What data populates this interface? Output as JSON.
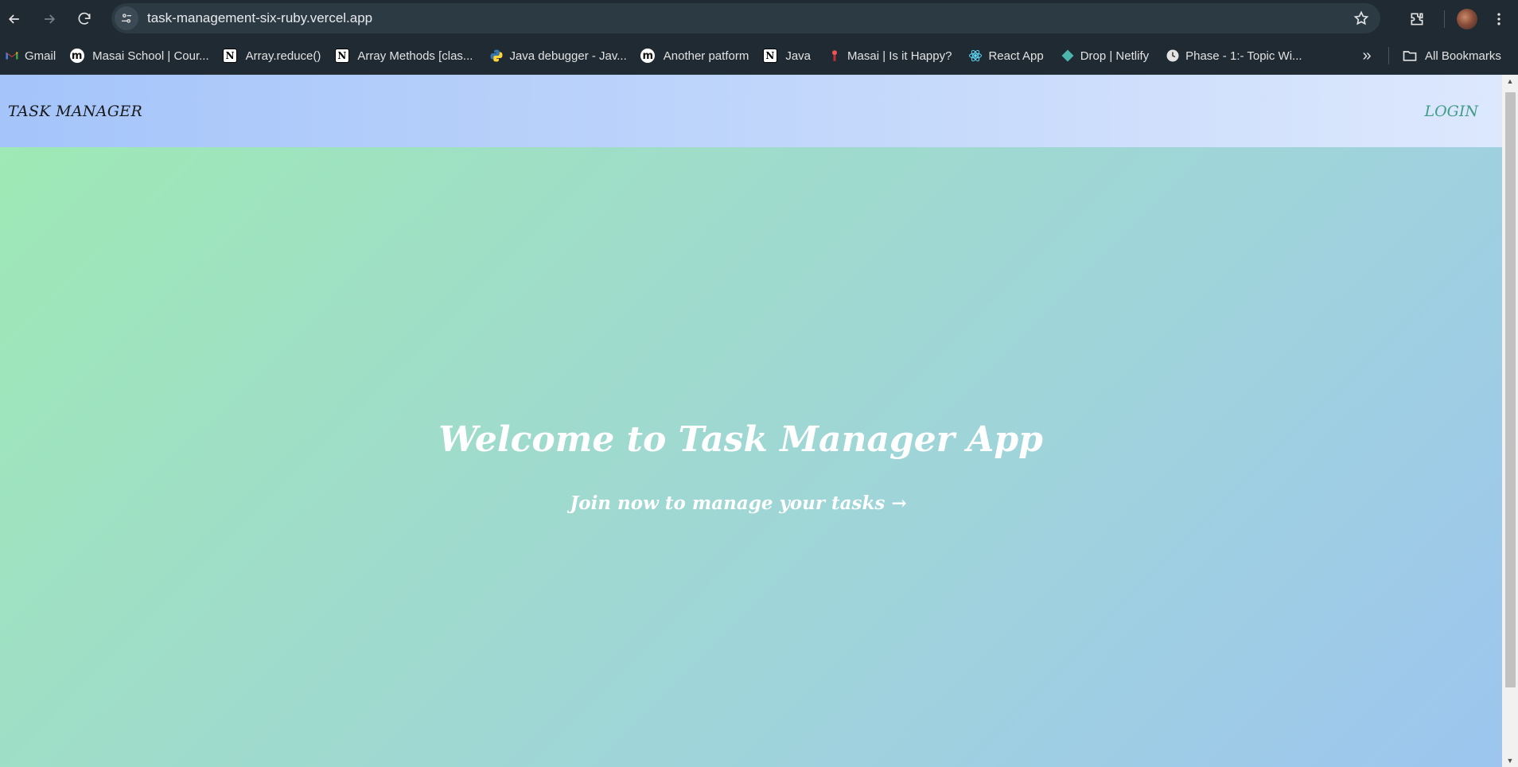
{
  "browser": {
    "url": "task-management-six-ruby.vercel.app",
    "bookmarks": [
      {
        "label": "Gmail",
        "icon": "gmail-icon"
      },
      {
        "label": "Masai School | Cour...",
        "icon": "masai-icon"
      },
      {
        "label": "Array.reduce()",
        "icon": "notion-icon"
      },
      {
        "label": "Array Methods [clas...",
        "icon": "notion-icon"
      },
      {
        "label": "Java debugger - Jav...",
        "icon": "python-icon"
      },
      {
        "label": "Another patform",
        "icon": "masai-icon"
      },
      {
        "label": "Java",
        "icon": "notion-icon"
      },
      {
        "label": "Masai | Is it Happy?",
        "icon": "masai-happy-icon"
      },
      {
        "label": "React App",
        "icon": "react-icon"
      },
      {
        "label": "Drop | Netlify",
        "icon": "netlify-icon"
      },
      {
        "label": "Phase - 1:- Topic Wi...",
        "icon": "clock-icon"
      }
    ],
    "all_bookmarks_label": "All Bookmarks"
  },
  "app": {
    "brand": "TASK MANAGER",
    "login_label": "LOGIN",
    "hero_title": "Welcome to Task Manager App",
    "hero_cta": "Join now to manage your tasks →"
  },
  "colors": {
    "nav_gradient_start": "#a4c4fa",
    "nav_gradient_end": "#dde8fd",
    "hero_gradient_start": "#9ee9b5",
    "hero_gradient_end": "#9dc5ef",
    "login_color": "#3f9d86"
  }
}
